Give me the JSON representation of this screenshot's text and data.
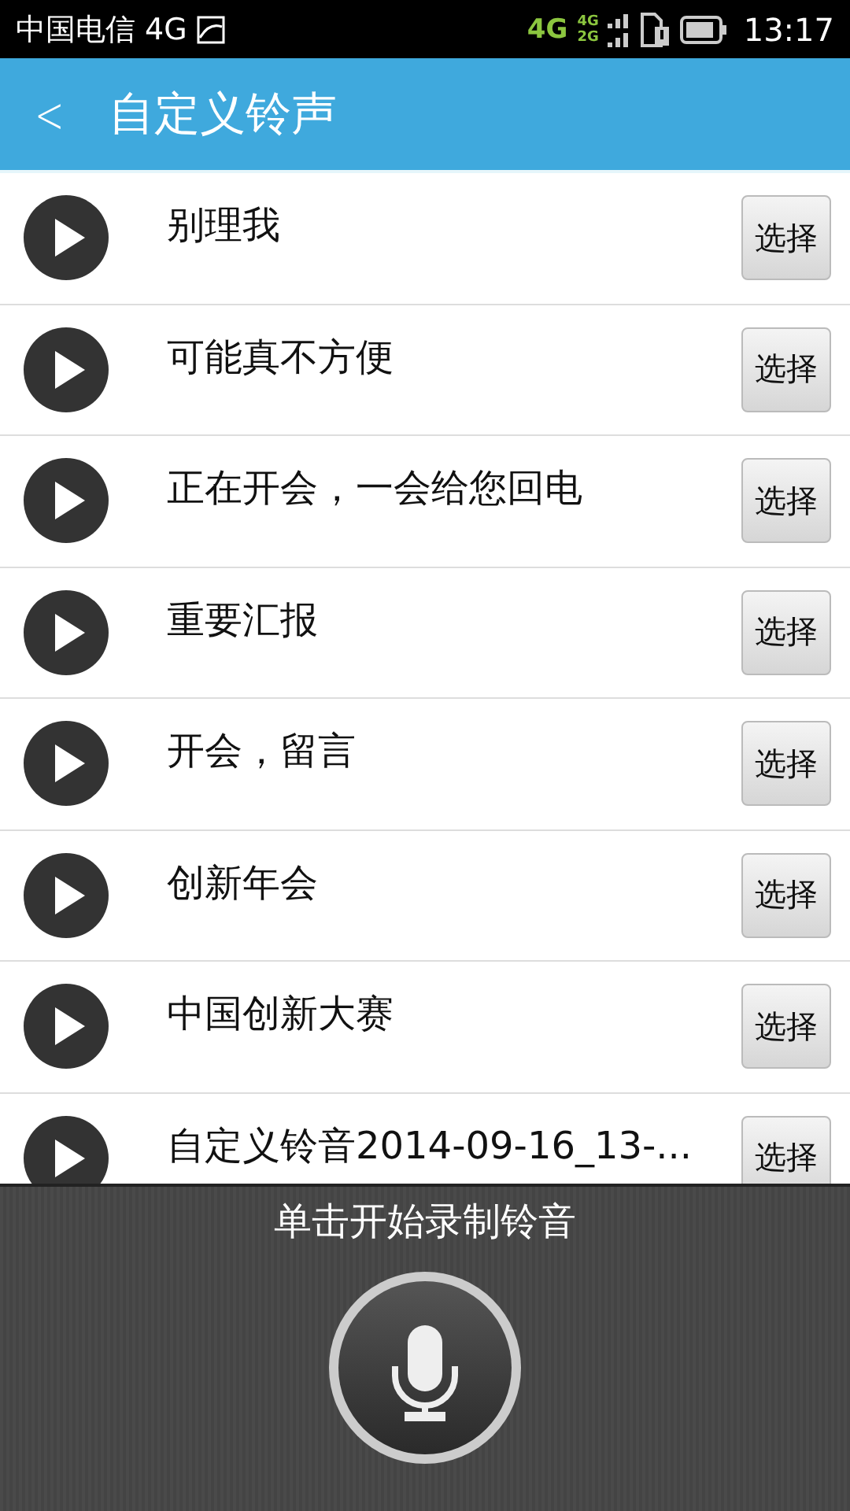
{
  "status_bar": {
    "carrier": "中国电信 4G",
    "network_primary": "4G",
    "network_secondary_top": "4G",
    "network_secondary_bottom": "2G",
    "time": "13:17"
  },
  "header": {
    "back": "<",
    "title": "自定义铃声"
  },
  "ringtones": [
    {
      "name": "别理我",
      "action": "选择"
    },
    {
      "name": "可能真不方便",
      "action": "选择"
    },
    {
      "name": "正在开会，一会给您回电",
      "action": "选择"
    },
    {
      "name": "重要汇报",
      "action": "选择"
    },
    {
      "name": "开会，留言",
      "action": "选择"
    },
    {
      "name": "创新年会",
      "action": "选择"
    },
    {
      "name": "中国创新大赛",
      "action": "选择"
    },
    {
      "name": "自定义铃音2014-09-16_13-...",
      "action": "选择"
    }
  ],
  "record_panel": {
    "hint": "单击开始录制铃音"
  }
}
